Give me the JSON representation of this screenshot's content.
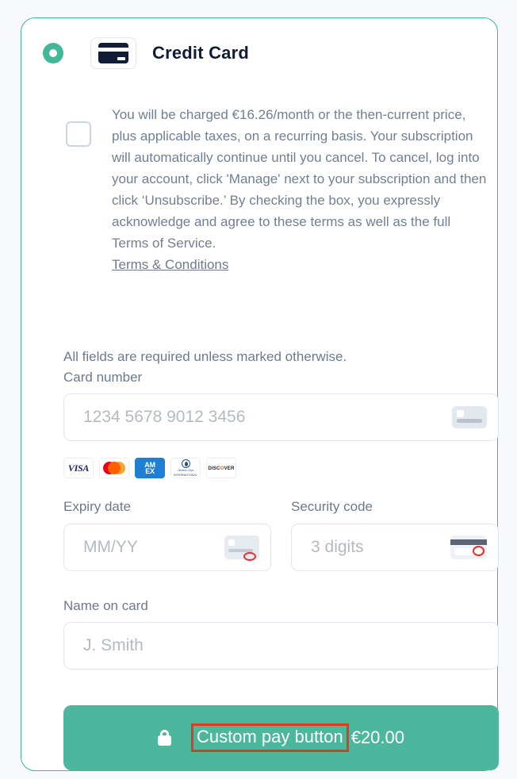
{
  "payment_method": {
    "selected": true,
    "icon": "credit-card-icon",
    "label": "Credit Card"
  },
  "terms": {
    "checked": false,
    "text": "You will be charged €16.26/month or the then-current price, plus applicable taxes, on a recurring basis. Your subscription will automatically continue until you cancel. To cancel, log into your account, click 'Manage' next to your subscription and then click ‘Unsubscribe.’ By checking the box, you expressly acknowledge and agree to these terms as well as the full Terms of Service.",
    "link_label": "Terms & Conditions"
  },
  "form": {
    "required_note": "All fields are required unless marked otherwise.",
    "card_number": {
      "label": "Card number",
      "placeholder": "1234 5678 9012 3456",
      "value": "",
      "icon": "card-placeholder-icon"
    },
    "expiry": {
      "label": "Expiry date",
      "placeholder": "MM/YY",
      "value": "",
      "icon": "card-expiry-icon"
    },
    "security_code": {
      "label": "Security code",
      "placeholder": "3 digits",
      "value": "",
      "icon": "card-back-cvv-icon"
    },
    "name_on_card": {
      "label": "Name on card",
      "placeholder": "J. Smith",
      "value": ""
    }
  },
  "accepted_cards": [
    {
      "id": "visa",
      "label": "VISA"
    },
    {
      "id": "mastercard",
      "label": "Mastercard"
    },
    {
      "id": "amex_line1",
      "label": "AM"
    },
    {
      "id": "amex_line2",
      "label": "EX"
    },
    {
      "id": "diners",
      "label": "Diners Club"
    },
    {
      "id": "diners_sub",
      "label": "INTERNATIONAL"
    },
    {
      "id": "discover_1",
      "label": "DISC"
    },
    {
      "id": "discover_o",
      "label": "O"
    },
    {
      "id": "discover_2",
      "label": "VER"
    }
  ],
  "pay_button": {
    "lock_icon": "lock-icon",
    "label": "Custom pay button",
    "amount": "€20.00"
  },
  "colors": {
    "accent_teal": "#4cb79c",
    "card_border": "#3fb69b",
    "page_background": "#f7f9fc",
    "text_dark": "#101c36",
    "text_muted": "#6c7a90",
    "annotation_red": "#e03b1c"
  }
}
